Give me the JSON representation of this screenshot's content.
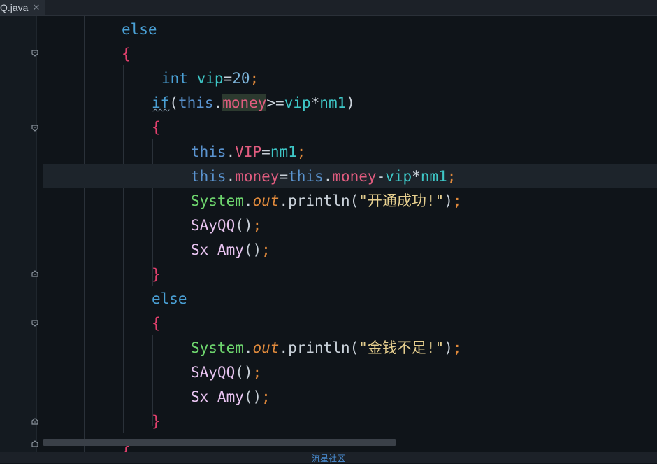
{
  "tab": {
    "title": "Q.java",
    "close": "✕"
  },
  "code": {
    "else1": "else",
    "brace_open": "{",
    "brace_close": "}",
    "int_kw": "int",
    "vip_decl": "vip",
    "vip_value": "20",
    "if_kw": "if",
    "this": "this",
    "money": "money",
    "op_ge": ">=",
    "vip": "vip",
    "times": "*",
    "nm1": "nm1",
    "VIP": "VIP",
    "eq": "=",
    "minus": "-",
    "dot": ".",
    "semi": ";",
    "lparen": "(",
    "rparen": ")",
    "System": "System",
    "out": "out",
    "println": "println",
    "msg_success": "\"开通成功!\"",
    "msg_fail": "\"金钱不足!\"",
    "SAyQQ": "SAyQQ",
    "Sx_Amy": "Sx_Amy",
    "call_parens": "()",
    "else2": "else"
  },
  "status": {
    "watermark": "流星社区"
  },
  "colors": {
    "background": "#0f1419",
    "keyword": "#4aa0d5",
    "field": "#e15c7f",
    "variable": "#3ec7c7",
    "string": "#e6cf8f",
    "system": "#6ed66e",
    "brace": "#e2406d",
    "semicolon": "#e0893b"
  }
}
